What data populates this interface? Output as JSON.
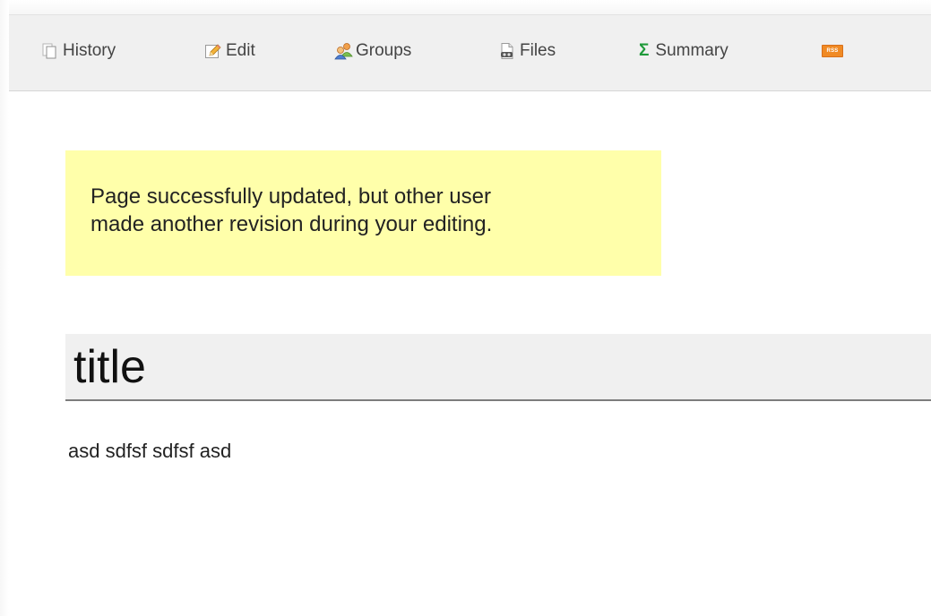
{
  "toolbar": {
    "items": [
      {
        "label": "History",
        "icon": "history-icon"
      },
      {
        "label": "Edit",
        "icon": "edit-pencil-icon"
      },
      {
        "label": "Groups",
        "icon": "groups-icon"
      },
      {
        "label": "Files",
        "icon": "files-icon"
      },
      {
        "label": "Summary",
        "icon": "sigma-summary-icon",
        "glyph": "Σ"
      },
      {
        "label": "",
        "icon": "rss-icon",
        "badge": "RSS"
      }
    ]
  },
  "notice": {
    "line1": "Page successfully updated, but other user",
    "line2": "made another revision during your editing."
  },
  "page": {
    "title": "title",
    "body": "asd sdfsf sdfsf asd"
  },
  "colors": {
    "notice_background": "#ffffaa",
    "toolbar_background": "#f0f0f0",
    "heading_background": "#f0f0f0",
    "summary_sigma": "#1f9a3a",
    "rss_orange": "#f08a24"
  }
}
